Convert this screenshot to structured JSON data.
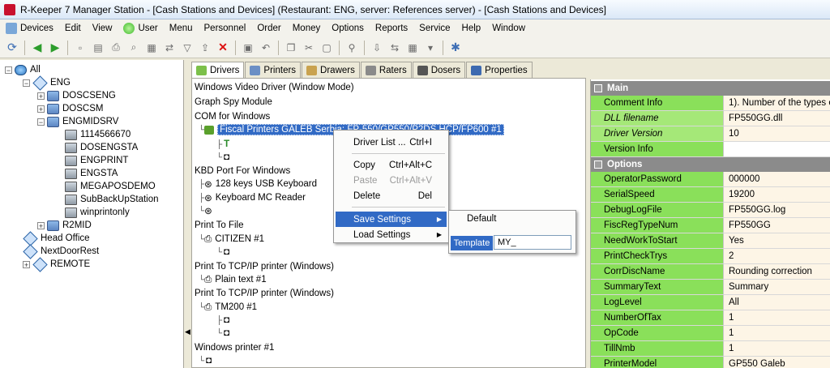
{
  "window": {
    "title": "R-Keeper 7 Manager Station - [Cash Stations and Devices] (Restaurant: ENG, server: References server) - [Cash Stations and Devices]"
  },
  "menu": [
    "Devices",
    "Edit",
    "View",
    "User",
    "Menu",
    "Personnel",
    "Order",
    "Money",
    "Options",
    "Reports",
    "Service",
    "Help",
    "Window"
  ],
  "tree": {
    "all": "All",
    "eng": "ENG",
    "doscseng": "DOSCSENG",
    "doscsm": "DOSCSM",
    "engmidsrv": "ENGMIDSRV",
    "n1114566670": "1114566670",
    "dosengsta": "DOSENGSTA",
    "engprint": "ENGPRINT",
    "engsta": "ENGSTA",
    "megaposdemo": "MEGAPOSDEMO",
    "subbackup": "SubBackUpStation",
    "winprintonly": "winprintonly",
    "r2mid": "R2MID",
    "headoffice": "Head Office",
    "nextdoor": "NextDoorRest",
    "remote": "REMOTE"
  },
  "tabs": [
    "Drivers",
    "Printers",
    "Drawers",
    "Raters",
    "Dosers",
    "Properties"
  ],
  "drivers": {
    "wvd": "Windows Video Driver (Window Mode)",
    "graphspy": "Graph Spy Module",
    "com": "COM for Windows",
    "fiscal": "Fiscal Printers GALEB Serbia: FP-550/GP550/P2DS HCP/FP600 #1",
    "kbd": "KBD Port For Windows",
    "kbd1": "128 keys USB Keyboard",
    "kbd2": "Keyboard MC Reader",
    "ptf": "Print To File",
    "citizen": "CITIZEN #1",
    "tcp1": "Print To TCP/IP printer (Windows)",
    "plain": "Plain text #1",
    "tcp2": "Print To TCP/IP printer (Windows)",
    "tm200": "TM200 #1",
    "winprinter": "Windows printer #1"
  },
  "context_menu": {
    "driver_list": "Driver List ...",
    "driver_list_sc": "Ctrl+I",
    "copy": "Copy",
    "copy_sc": "Ctrl+Alt+C",
    "paste": "Paste",
    "paste_sc": "Ctrl+Alt+V",
    "delete": "Delete",
    "delete_sc": "Del",
    "save_settings": "Save Settings",
    "load_settings": "Load Settings"
  },
  "submenu": {
    "default": "Default",
    "template_label": "Template",
    "template_value": "MY_"
  },
  "properties": {
    "main_header": "Main",
    "main": [
      {
        "name": "Comment Info",
        "value": "1). Number of the types o"
      },
      {
        "name": "DLL filename",
        "value": "FP550GG.dll"
      },
      {
        "name": "Driver Version",
        "value": "10"
      },
      {
        "name": "Version Info",
        "value": ""
      }
    ],
    "options_header": "Options",
    "options": [
      {
        "name": "OperatorPassword",
        "value": "000000"
      },
      {
        "name": "SerialSpeed",
        "value": "19200"
      },
      {
        "name": "DebugLogFile",
        "value": "FP550GG.log"
      },
      {
        "name": "FiscRegTypeNum",
        "value": "FP550GG"
      },
      {
        "name": "NeedWorkToStart",
        "value": "Yes"
      },
      {
        "name": "PrintCheckTrys",
        "value": "2"
      },
      {
        "name": "CorrDiscName",
        "value": "Rounding correction"
      },
      {
        "name": "SummaryText",
        "value": "Summary"
      },
      {
        "name": "LogLevel",
        "value": "All"
      },
      {
        "name": "NumberOfTax",
        "value": "1"
      },
      {
        "name": "OpCode",
        "value": "1"
      },
      {
        "name": "TillNmb",
        "value": "1"
      },
      {
        "name": "PrinterModel",
        "value": "GP550 Galeb"
      }
    ]
  }
}
